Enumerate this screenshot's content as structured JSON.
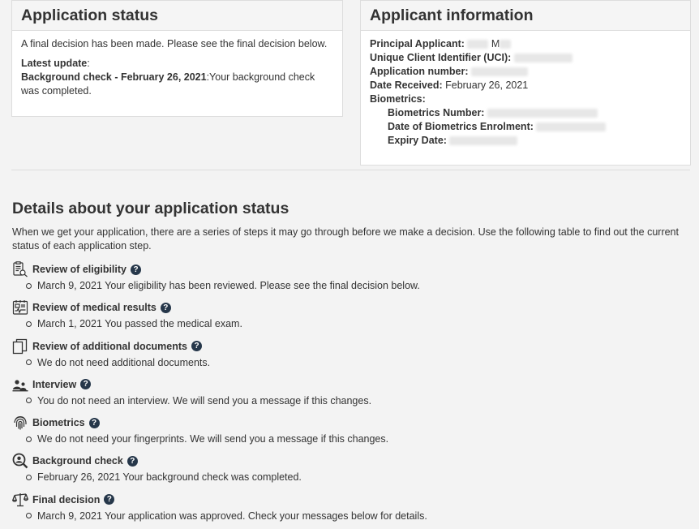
{
  "status_panel": {
    "title": "Application status",
    "message": "A final decision has been made. Please see the final decision below.",
    "latest_update_label": "Latest update",
    "latest_update_colon": ":",
    "update_title": "Background check - February 26, 2021",
    "update_text": ":Your background check was completed."
  },
  "applicant_panel": {
    "title": "Applicant information",
    "principal_label": "Principal Applicant:",
    "principal_visible": "M",
    "uci_label": "Unique Client Identifier (UCI):",
    "app_number_label": "Application number:",
    "date_received_label": "Date Received:",
    "date_received_value": "February 26, 2021",
    "biometrics_label": "Biometrics:",
    "bio_number_label": "Biometrics Number:",
    "bio_enrol_label": "Date of Biometrics Enrolment:",
    "expiry_label": "Expiry Date:"
  },
  "details": {
    "title": "Details about your application status",
    "intro": "When we get your application, there are a series of steps it may go through before we make a decision. Use the following table to find out the current status of each application step.",
    "steps": [
      {
        "label": "Review of eligibility",
        "icon": "clipboard-magnifier-icon",
        "text": "March 9, 2021 Your eligibility has been reviewed. Please see the final decision below."
      },
      {
        "label": "Review of medical results",
        "icon": "medical-report-icon",
        "text": "March 1, 2021 You passed the medical exam."
      },
      {
        "label": "Review of additional documents",
        "icon": "documents-icon",
        "text": "We do not need additional documents."
      },
      {
        "label": "Interview",
        "icon": "people-icon",
        "text": "You do not need an interview. We will send you a message if this changes."
      },
      {
        "label": "Biometrics",
        "icon": "fingerprint-icon",
        "text": "We do not need your fingerprints. We will send you a message if this changes."
      },
      {
        "label": "Background check",
        "icon": "person-search-icon",
        "text": "February 26, 2021 Your background check was completed."
      },
      {
        "label": "Final decision",
        "icon": "scales-icon",
        "text": "March 9, 2021 Your application was approved. Check your messages below for details."
      }
    ]
  },
  "help_glyph": "?"
}
